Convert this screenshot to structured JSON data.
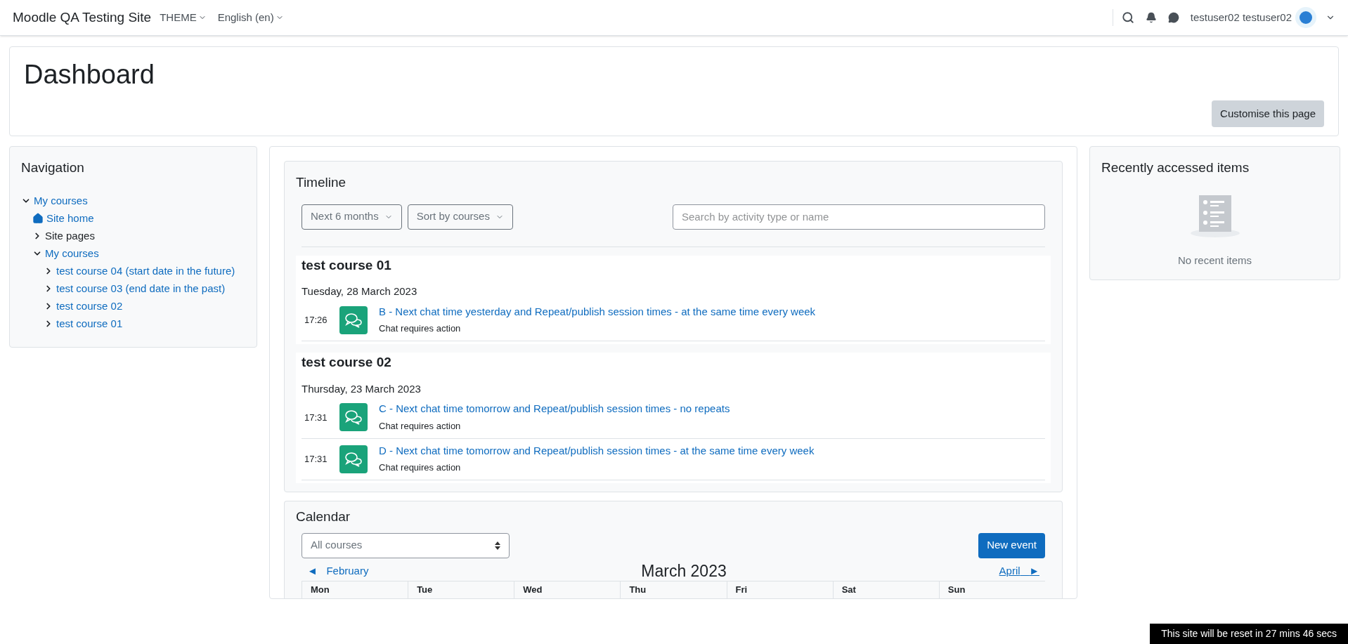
{
  "navbar": {
    "site_name": "Moodle QA Testing Site",
    "menus": [
      "THEME",
      "English (en)"
    ],
    "user_name": "testuser02 testuser02"
  },
  "page_header": {
    "title": "Dashboard",
    "button": "Customise this page"
  },
  "navigation": {
    "title": "Navigation",
    "tree": [
      {
        "label": "My courses",
        "kind": "link",
        "expanded": true,
        "children": [
          {
            "label": "Site home",
            "kind": "home"
          },
          {
            "label": "Site pages",
            "kind": "plain",
            "expanded": false
          },
          {
            "label": "My courses",
            "kind": "link",
            "expanded": true,
            "children": [
              {
                "label": "test course 04 (start date in the future)",
                "kind": "link",
                "expanded": false
              },
              {
                "label": "test course 03 (end date in the past)",
                "kind": "link",
                "expanded": false
              },
              {
                "label": "test course 02",
                "kind": "link",
                "expanded": false
              },
              {
                "label": "test course 01",
                "kind": "link",
                "expanded": false
              }
            ]
          }
        ]
      }
    ]
  },
  "timeline": {
    "title": "Timeline",
    "filters": [
      "Next 6 months",
      "Sort by courses"
    ],
    "search": {
      "placeholder": "Search by activity type or name"
    },
    "courses": [
      {
        "name": "test course 01",
        "date": "Tuesday, 28 March 2023",
        "events": [
          {
            "time": "17:26",
            "title": "B - Next chat time yesterday and Repeat/publish session times - at the same time every week",
            "status": "Chat requires action"
          }
        ]
      },
      {
        "name": "test course 02",
        "date": "Thursday, 23 March 2023",
        "events": [
          {
            "time": "17:31",
            "title": "C - Next chat time tomorrow and Repeat/publish session times - no repeats",
            "status": "Chat requires action"
          },
          {
            "time": "17:31",
            "title": "D - Next chat time tomorrow and Repeat/publish session times - at the same time every week",
            "status": "Chat requires action"
          }
        ]
      }
    ]
  },
  "calendar": {
    "title": "Calendar",
    "course_select": "All courses",
    "new_event": "New event",
    "prev": {
      "arrow": "◄",
      "label": "February"
    },
    "month": "March 2023",
    "next": {
      "label": "April",
      "arrow": "►"
    },
    "weekdays": [
      "Mon",
      "Tue",
      "Wed",
      "Thu",
      "Fri",
      "Sat",
      "Sun"
    ]
  },
  "recent": {
    "title": "Recently accessed items",
    "empty": "No recent items"
  },
  "reset_notice": "This site will be reset in 27 mins 46 secs"
}
